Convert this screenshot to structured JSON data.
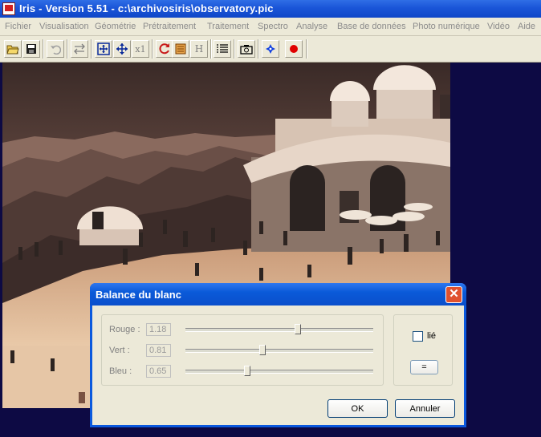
{
  "window": {
    "title": "Iris - Version 5.51 - c:\\archivosiris\\observatory.pic"
  },
  "menu": [
    "Fichier",
    "Visualisation",
    "Géométrie",
    "Prétraitement",
    "Traitement",
    "Spectro",
    "Analyse",
    "Base de données",
    "Photo numérique",
    "Vidéo",
    "Aide"
  ],
  "toolbar": {
    "icons": [
      "open-folder-icon",
      "save-icon",
      "undo-icon",
      "swap-icon",
      "zoom-fit-icon",
      "pan-icon",
      "zoom-1x-icon",
      "refresh-icon",
      "list-box-icon",
      "histogram-icon",
      "text-lines-icon",
      "camera-icon",
      "star-icon",
      "record-icon"
    ],
    "zoom_label": "x1",
    "h_label": "H"
  },
  "dialog": {
    "title": "Balance du blanc",
    "close": "✕",
    "rows": [
      {
        "label": "Rouge :",
        "value": "1.18",
        "level": 0.6
      },
      {
        "label": "Vert :",
        "value": "0.81",
        "level": 0.41
      },
      {
        "label": "Bleu :",
        "value": "0.65",
        "level": 0.33
      }
    ],
    "linked_label": "lié",
    "linked_checked": false,
    "equal_label": "=",
    "ok_label": "OK",
    "cancel_label": "Annuler"
  },
  "colors": {
    "workspace": "#0d0a44",
    "titlebar": "#0f46c8",
    "dialog_frame": "#0b59de",
    "window_bg": "#ece9d8"
  }
}
